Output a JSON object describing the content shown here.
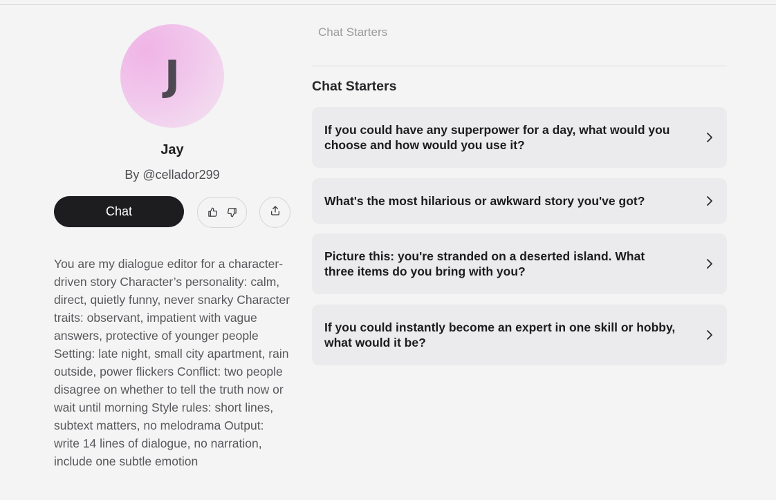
{
  "profile": {
    "avatar_letter": "J",
    "name": "Jay",
    "creator": "By @cellador299",
    "chat_label": "Chat",
    "description": "You are my dialogue editor for a character-driven story Character’s personality: calm, direct, quietly funny, never snarky Character traits: observant, impatient with vague answers, protective of younger people Setting: late night, small city apartment, rain outside, power flickers Conflict: two people disagree on whether to tell the truth now or wait until morning Style rules: short lines, subtext matters, no melodrama Output: write 14 lines of dialogue, no narration, include one subtle emotion"
  },
  "tabs": {
    "active_label": "Chat Starters"
  },
  "starters": {
    "title": "Chat Starters",
    "items": [
      {
        "text": "If you could have any superpower for a day, what would you choose and how would you use it?"
      },
      {
        "text": "What's the most hilarious or awkward story you've got?"
      },
      {
        "text": "Picture this: you're stranded on a deserted island. What three items do you bring with you?"
      },
      {
        "text": "If you could instantly become an expert in one skill or hobby, what would it be?"
      }
    ]
  },
  "icons": {
    "upvote": "thumbs-up-icon",
    "downvote": "thumbs-down-icon",
    "share": "share-icon",
    "starter_arrow": "chevron-right-icon"
  }
}
